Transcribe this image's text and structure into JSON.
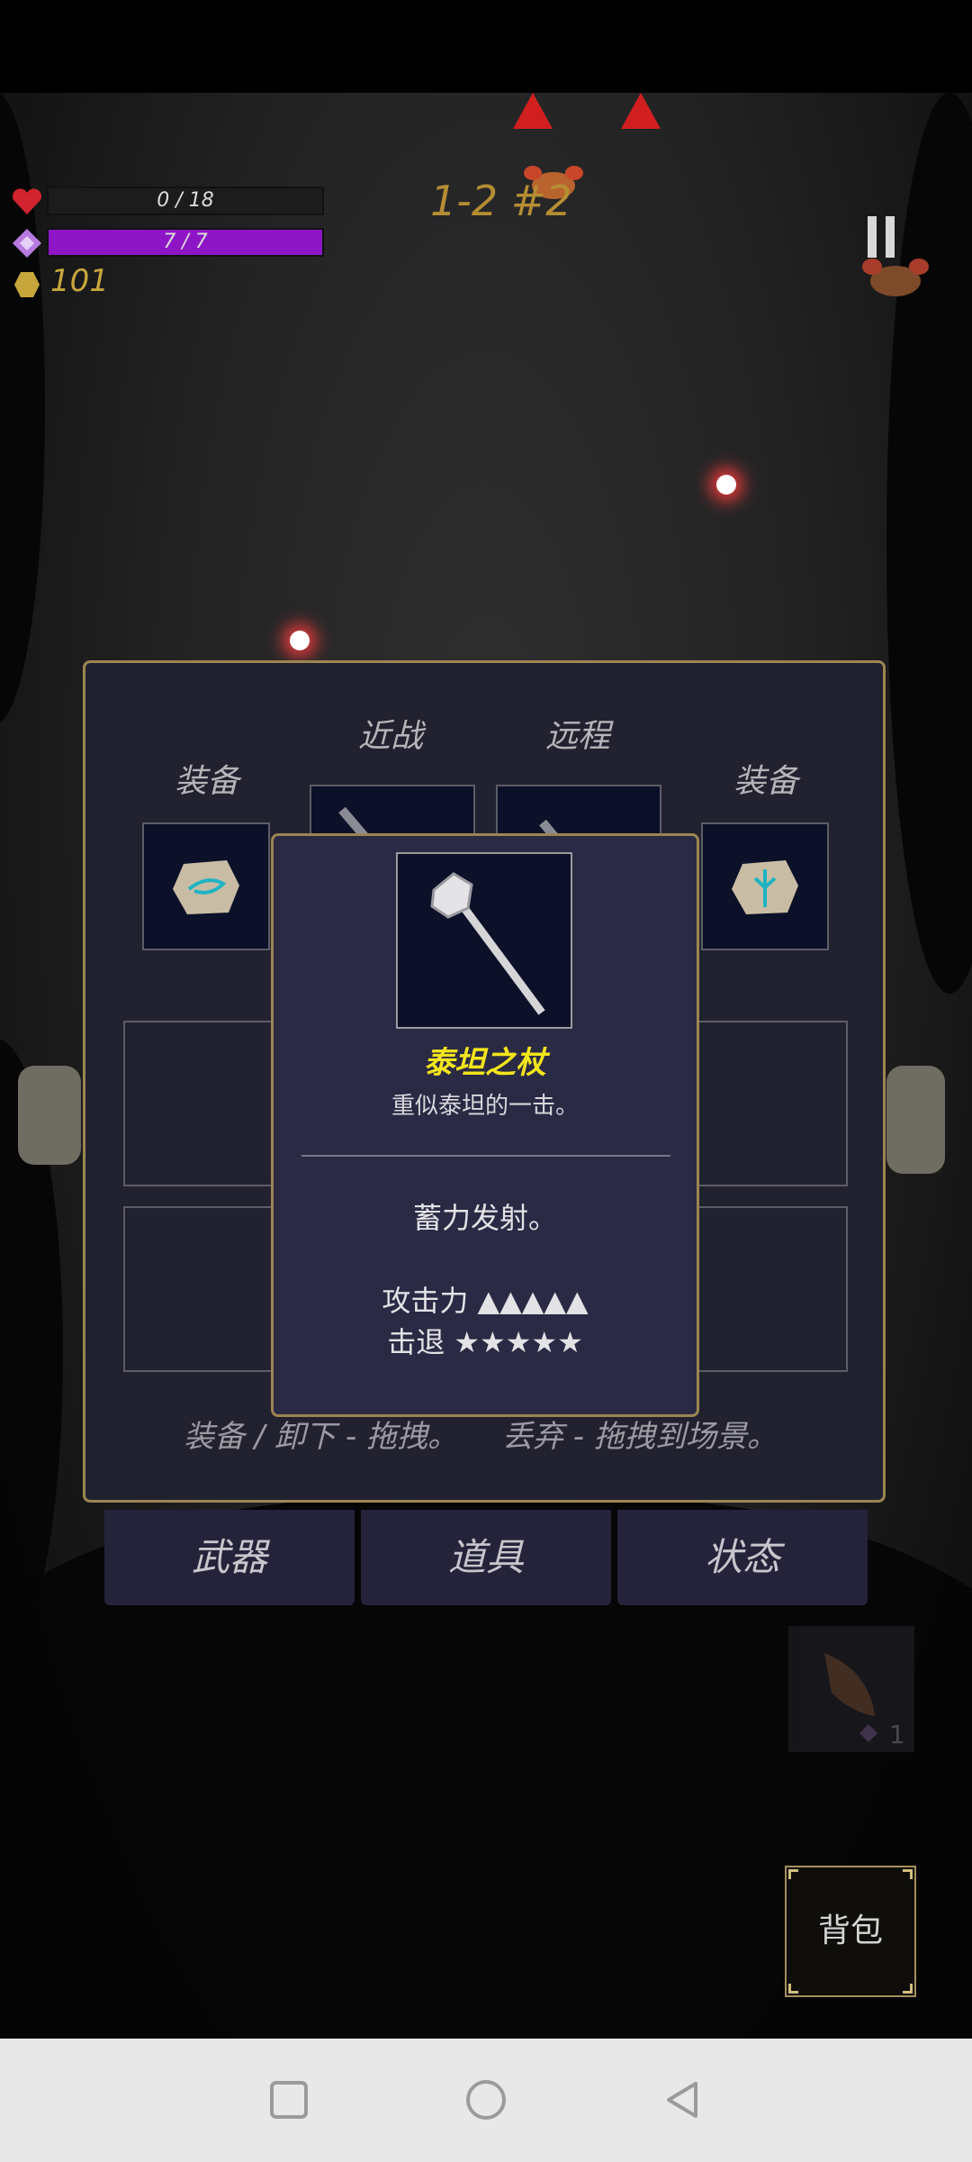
{
  "hud": {
    "hp_text": "0 / 18",
    "hp_fraction": 0,
    "mp_text": "7 / 7",
    "mp_fraction": 1,
    "coins": "101",
    "level": "1-2 #2"
  },
  "equipment_panel": {
    "header_melee": "近战",
    "header_ranged": "远程",
    "header_equip_left": "装备",
    "header_equip_right": "装备",
    "hint_equip": "装备 / 卸下 - 拖拽。",
    "hint_discard": "丢弃 - 拖拽到场景。"
  },
  "tooltip": {
    "name": "泰坦之杖",
    "description": "重似泰坦的一击。",
    "effect": "蓄力发射。",
    "attack_label": "攻击力 ▲▲▲▲▲",
    "knockback_label": "击退 ★★★★★",
    "attack_level": 5,
    "knockback_level": 5
  },
  "tabs": {
    "weapons": "武器",
    "items": "道具",
    "status": "状态"
  },
  "inventory": {
    "shell_count": "1"
  },
  "backpack_label": "背包",
  "colors": {
    "hp_bar_bg": "#1c1c1c",
    "mp_bar": "#8e15c6",
    "coin": "#c7a63c",
    "panel_border": "#9c8552",
    "item_name": "#f2e51b"
  },
  "icons": {
    "heart": "heart-icon",
    "mana": "mana-diamond-icon",
    "coin": "coin-icon",
    "pause": "pause-icon"
  }
}
